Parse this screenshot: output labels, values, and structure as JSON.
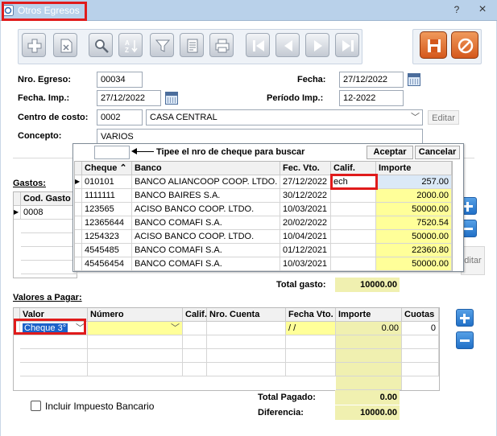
{
  "window": {
    "title": "Otros Egresos",
    "help_btn": "?",
    "close_btn": "×"
  },
  "form": {
    "nro_egreso_label": "Nro. Egreso:",
    "nro_egreso": "00034",
    "fecha_label": "Fecha:",
    "fecha": "27/12/2022",
    "fecha_imp_label": "Fecha. Imp.:",
    "fecha_imp": "27/12/2022",
    "periodo_label": "Período Imp.:",
    "periodo": "12-2022",
    "centro_label": "Centro de costo:",
    "centro_code": "0002",
    "centro_name": "CASA CENTRAL",
    "editar_label": "Editar",
    "concepto_label": "Concepto:",
    "concepto": "VARIOS"
  },
  "gastos": {
    "label": "Gastos:",
    "col_cod": "Cod. Gasto",
    "rows": [
      "0008"
    ],
    "total_label": "Total gasto:",
    "total": "10000.00",
    "editar_partial": "ditar"
  },
  "popup": {
    "search_hint": "Tipee el nro de cheque para buscar",
    "aceptar": "Aceptar",
    "cancelar": "Cancelar",
    "cols": {
      "cheque": "Cheque",
      "banco": "Banco",
      "fec_vto": "Fec. Vto.",
      "calif": "Calif.",
      "importe": "Importe"
    },
    "calif_value": "ech",
    "rows": [
      {
        "cheque": "010101",
        "banco": "BANCO ALIANCOOP COOP. LTDO.",
        "fecha": "27/12/2022",
        "importe": "257.00"
      },
      {
        "cheque": "1111111",
        "banco": "BANCO BAIRES S.A.",
        "fecha": "30/12/2022",
        "importe": "2000.00"
      },
      {
        "cheque": "123565",
        "banco": "ACISO BANCO COOP. LTDO.",
        "fecha": "10/03/2021",
        "importe": "50000.00"
      },
      {
        "cheque": "12365644",
        "banco": "BANCO COMAFI S.A.",
        "fecha": "20/02/2022",
        "importe": "7520.54"
      },
      {
        "cheque": "1254323",
        "banco": "ACISO BANCO COOP. LTDO.",
        "fecha": "10/04/2021",
        "importe": "50000.00"
      },
      {
        "cheque": "4545485",
        "banco": "BANCO COMAFI S.A.",
        "fecha": "01/12/2021",
        "importe": "22360.80"
      },
      {
        "cheque": "45456454",
        "banco": "BANCO COMAFI S.A.",
        "fecha": "10/03/2021",
        "importe": "50000.00"
      }
    ]
  },
  "valores": {
    "label": "Valores a Pagar:",
    "cols": {
      "valor": "Valor",
      "numero": "Número",
      "calif": "Calif.",
      "nro_cuenta": "Nro. Cuenta",
      "fecha_vto": "Fecha Vto.",
      "importe": "Importe",
      "cuotas": "Cuotas"
    },
    "row": {
      "valor": "Cheque 3°",
      "fecha": " / /",
      "importe": "0.00",
      "cuotas": "0"
    },
    "checkbox_label": "Incluir Impuesto Bancario",
    "total_pagado_label": "Total Pagado:",
    "total_pagado": "0.00",
    "diferencia_label": "Diferencia:",
    "diferencia": "10000.00"
  }
}
